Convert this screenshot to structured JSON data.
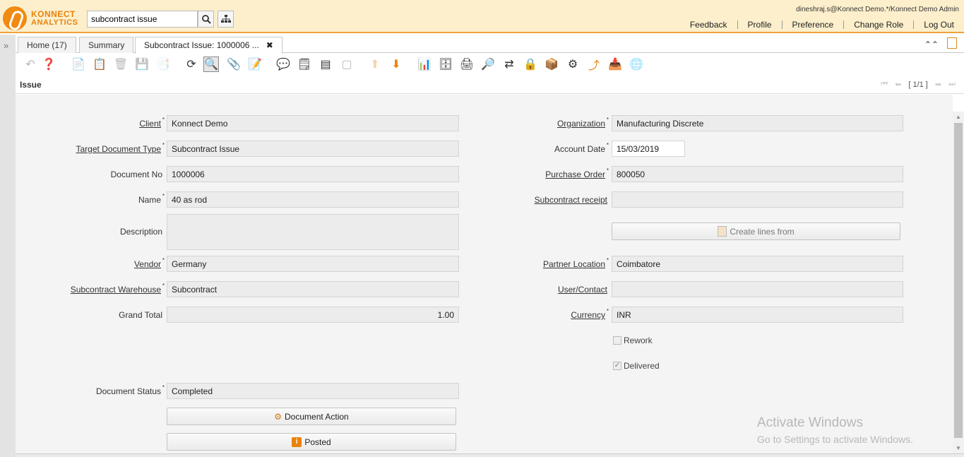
{
  "header": {
    "logo_line1": "KONNECT",
    "logo_line2": "ANALYTICS",
    "search_value": "subcontract issue",
    "user": "dineshraj.s@Konnect Demo.*/Konnect Demo Admin",
    "links": [
      "Feedback",
      "Profile",
      "Preference",
      "Change Role",
      "Log Out"
    ]
  },
  "tabs": [
    {
      "label": "Home (17)"
    },
    {
      "label": "Summary"
    },
    {
      "label": "Subcontract Issue: 1000006 ...",
      "active": true
    }
  ],
  "issue_bar": {
    "title": "Issue",
    "record": "[ 1/1 ]"
  },
  "form": {
    "client": {
      "label": "Client",
      "value": "Konnect Demo"
    },
    "target_doc_type": {
      "label": "Target Document Type",
      "value": "Subcontract Issue"
    },
    "document_no": {
      "label": "Document No",
      "value": "1000006"
    },
    "name": {
      "label": "Name",
      "value": "40 as rod"
    },
    "description": {
      "label": "Description",
      "value": ""
    },
    "vendor": {
      "label": "Vendor",
      "value": "Germany"
    },
    "subcontract_warehouse": {
      "label": "Subcontract Warehouse",
      "value": "Subcontract"
    },
    "grand_total": {
      "label": "Grand Total",
      "value": "1.00"
    },
    "document_status": {
      "label": "Document Status",
      "value": "Completed"
    },
    "document_action": {
      "label": "Document Action"
    },
    "posted": {
      "label": "Posted"
    },
    "organization": {
      "label": "Organization",
      "value": "Manufacturing Discrete"
    },
    "account_date": {
      "label": "Account Date",
      "value": "15/03/2019"
    },
    "purchase_order": {
      "label": "Purchase Order",
      "value": "800050"
    },
    "subcontract_receipt": {
      "label": "Subcontract receipt",
      "value": ""
    },
    "create_lines_from": {
      "label": "Create lines from"
    },
    "partner_location": {
      "label": "Partner Location",
      "value": "Coimbatore"
    },
    "user_contact": {
      "label": "User/Contact",
      "value": ""
    },
    "currency": {
      "label": "Currency",
      "value": "INR"
    },
    "rework": {
      "label": "Rework",
      "checked": false
    },
    "delivered": {
      "label": "Delivered",
      "checked": true
    }
  },
  "watermark": {
    "line1": "Activate Windows",
    "line2": "Go to Settings to activate Windows."
  },
  "colors": {
    "accent": "#f08a12",
    "topbar": "#fdefcc",
    "content_bg": "#f4f4f4"
  }
}
